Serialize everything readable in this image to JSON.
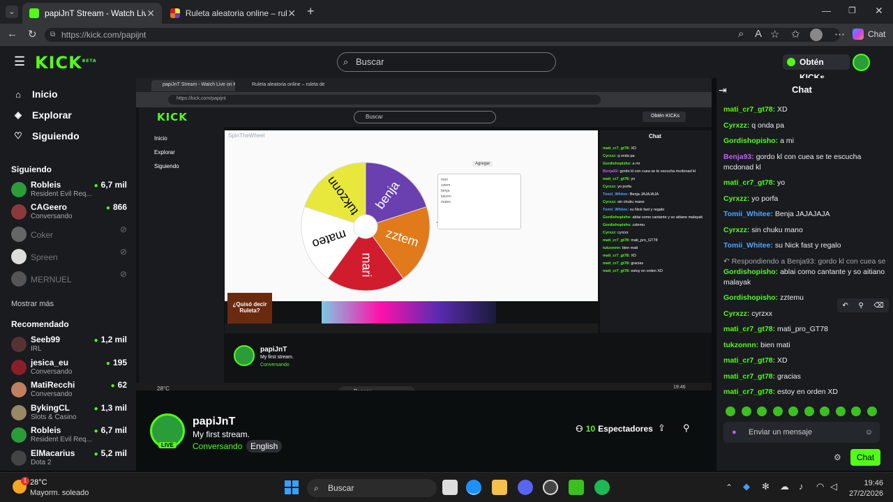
{
  "browser": {
    "tabs": [
      {
        "title": "papiJnT Stream - Watch Live on Ki",
        "active": true
      },
      {
        "title": "Ruleta aleatoria online – ruleta de l",
        "active": false
      }
    ],
    "url": "https://kick.com/papijnt",
    "chat_app_label": "Chat"
  },
  "header": {
    "search_placeholder": "Buscar",
    "kicks_button": "Obtén KICKs"
  },
  "nav": {
    "items": [
      "Inicio",
      "Explorar",
      "Siguiendo"
    ],
    "following_title": "Siguiendo",
    "show_more": "Mostrar más",
    "recommended_title": "Recomendado"
  },
  "following": [
    {
      "name": "Robleis",
      "sub": "Resident Evil Req...",
      "viewers": "6,7 mil",
      "online": true,
      "color": "#2a9d3a"
    },
    {
      "name": "CAGeero",
      "sub": "Conversando",
      "viewers": "866",
      "online": true,
      "color": "#8a3a3a"
    },
    {
      "name": "Coker",
      "sub": "",
      "viewers": "",
      "online": false,
      "color": "#666"
    },
    {
      "name": "Spreen",
      "sub": "",
      "viewers": "",
      "online": false,
      "color": "#ddd"
    },
    {
      "name": "MERNUEL",
      "sub": "",
      "viewers": "",
      "online": false,
      "color": "#555"
    }
  ],
  "recommended": [
    {
      "name": "Seeb99",
      "sub": "IRL",
      "viewers": "1,2 mil",
      "color": "#553333"
    },
    {
      "name": "jesica_eu",
      "sub": "Conversando",
      "viewers": "195",
      "color": "#8a1f2a"
    },
    {
      "name": "MatiRecchi",
      "sub": "Conversando",
      "viewers": "62",
      "color": "#c08060"
    },
    {
      "name": "BykingCL",
      "sub": "Slots & Casino",
      "viewers": "1,3 mil",
      "color": "#998866"
    },
    {
      "name": "Robleis",
      "sub": "Resident Evil Req...",
      "viewers": "6,7 mil",
      "color": "#2a9d3a"
    },
    {
      "name": "ElMacarius",
      "sub": "Dota 2",
      "viewers": "5,2 mil",
      "color": "#444"
    }
  ],
  "stream": {
    "streamer": "papiJnT",
    "title": "My first stream.",
    "category": "Conversando",
    "language": "English",
    "viewers": "10",
    "viewers_label": "Espectadores",
    "live_badge": "LIVE"
  },
  "wheel": {
    "segments": [
      "tukzonn",
      "benja",
      "zztem",
      "mari",
      "mateo"
    ],
    "colors": [
      "#e8e83c",
      "#6a3fb0",
      "#e07a1a",
      "#d01c2c",
      "#ffffff"
    ],
    "brand": "SpinTheWheel",
    "entries": [
      "mari",
      "zztem",
      "benja",
      "tukzon",
      "mateo"
    ],
    "add_button": "Agregar"
  },
  "ad": {
    "text": "¿Quisó decir Ruleta?"
  },
  "chat": {
    "title": "Chat",
    "messages": [
      {
        "user": "mati_cr7_gt78",
        "text": "XD",
        "color": "#53fc18"
      },
      {
        "user": "Cyrxzz",
        "text": "q onda pa",
        "color": "#53fc18"
      },
      {
        "user": "Gordishopisho",
        "text": "a mi",
        "color": "#53fc18"
      },
      {
        "user": "Benja93",
        "text": "gordo kl con cuea se te escucha mcdonad kl",
        "color": "#c65cff"
      },
      {
        "user": "mati_cr7_gt78",
        "text": "yo",
        "color": "#53fc18"
      },
      {
        "user": "Cyrxzz",
        "text": "yo porfa",
        "color": "#53fc18"
      },
      {
        "user": "Tomii_Whitee",
        "text": "Benja JAJAJAJA",
        "color": "#4da6ff"
      },
      {
        "user": "Cyrxzz",
        "text": "sin chuku mano",
        "color": "#53fc18"
      },
      {
        "user": "Tomii_Whitee",
        "text": "su Nick fast y regalo",
        "color": "#4da6ff"
      },
      {
        "user": "Gordishopisho",
        "text": "ablai como cantante y so aitiano malayak",
        "color": "#53fc18",
        "reply": "Respondiendo a Benja93: gordo kl con cuea se te escucha ..."
      },
      {
        "user": "Gordishopisho",
        "text": "zztemu",
        "color": "#53fc18"
      },
      {
        "user": "Cyrxzz",
        "text": "cyrzxx",
        "color": "#53fc18"
      },
      {
        "user": "mati_cr7_gt78",
        "text": "mati_pro_GT78",
        "color": "#53fc18"
      },
      {
        "user": "tukzonnn",
        "text": "bien mati",
        "color": "#53fc18"
      },
      {
        "user": "mati_cr7_gt78",
        "text": "XD",
        "color": "#53fc18"
      },
      {
        "user": "mati_cr7_gt78",
        "text": "gracias",
        "color": "#53fc18"
      },
      {
        "user": "mati_cr7_gt78",
        "text": "estoy en orden XD",
        "color": "#53fc18"
      }
    ],
    "input_placeholder": "Enviar un mensaje",
    "send_button": "Chat"
  },
  "taskbar": {
    "weather_temp": "28°C",
    "weather_desc": "Mayorm. soleado",
    "search": "Buscar",
    "time": "19:46",
    "date": "27/2/2026",
    "badge": "1"
  }
}
